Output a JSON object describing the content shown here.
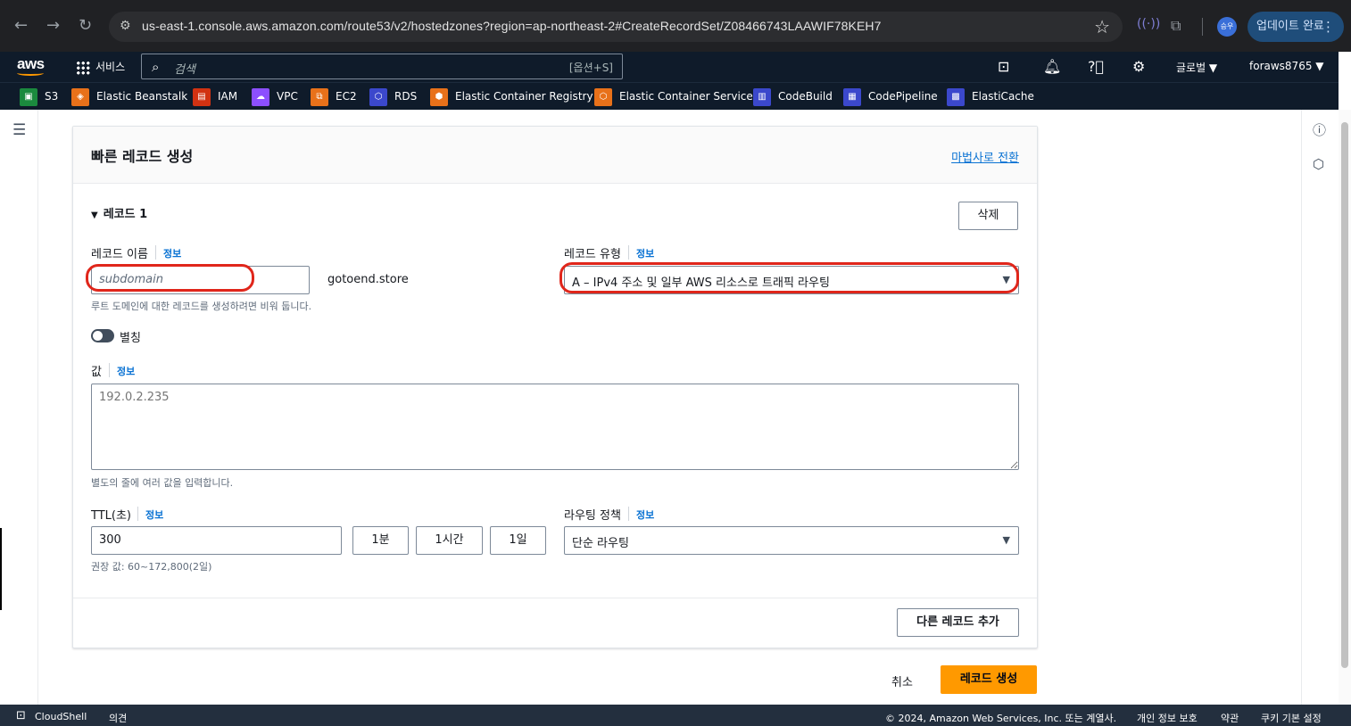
{
  "browser": {
    "url": "us-east-1.console.aws.amazon.com/route53/v2/hostedzones?region=ap-northeast-2#CreateRecordSet/Z08466743LAAWIF78KEH7",
    "update_label": "업데이트 완료",
    "profile_initial": "승우"
  },
  "awsnav": {
    "logo": "aws",
    "services": "서비스",
    "search_placeholder": "검색",
    "search_shortcut": "[옵션+S]",
    "region": "글로벌 ▼",
    "user": "foraws8765 ▼"
  },
  "favorites": [
    {
      "label": "S3",
      "color": "#1b8a3e"
    },
    {
      "label": "Elastic Beanstalk",
      "color": "#e8711a"
    },
    {
      "label": "IAM",
      "color": "#d13212"
    },
    {
      "label": "VPC",
      "color": "#8c4fff"
    },
    {
      "label": "EC2",
      "color": "#e8711a"
    },
    {
      "label": "RDS",
      "color": "#3b48cc"
    },
    {
      "label": "Elastic Container Registry",
      "color": "#e8711a"
    },
    {
      "label": "Elastic Container Service",
      "color": "#e8711a"
    },
    {
      "label": "CodeBuild",
      "color": "#3b48cc"
    },
    {
      "label": "CodePipeline",
      "color": "#3b48cc"
    },
    {
      "label": "ElastiCache",
      "color": "#3b48cc"
    }
  ],
  "page": {
    "title": "빠른 레코드 생성",
    "wizard_link": "마법사로 전환",
    "record_section": "레코드 1",
    "delete_button": "삭제",
    "record_name_label": "레코드 이름",
    "info": "정보",
    "record_name_placeholder": "subdomain",
    "domain_suffix": "gotoend.store",
    "record_name_hint": "루트 도메인에 대한 레코드를 생성하려면 비워 둡니다.",
    "record_type_label": "레코드 유형",
    "record_type_value": "A – IPv4 주소 및 일부 AWS 리소스로 트래픽 라우팅",
    "alias_label": "별칭",
    "value_label": "값",
    "value_placeholder": "192.0.2.235",
    "value_hint": "별도의 줄에 여러 값을 입력합니다.",
    "ttl_label": "TTL(초)",
    "ttl_value": "300",
    "ttl_1m": "1분",
    "ttl_1h": "1시간",
    "ttl_1d": "1일",
    "ttl_hint": "권장 값: 60~172,800(2일)",
    "routing_label": "라우팅 정책",
    "routing_value": "단순 라우팅",
    "add_record_button": "다른 레코드 추가",
    "cancel_button": "취소",
    "create_button": "레코드 생성"
  },
  "footer": {
    "cloudshell": "CloudShell",
    "feedback": "의견",
    "copyright": "© 2024, Amazon Web Services, Inc. 또는 계열사.",
    "privacy": "개인 정보 보호",
    "terms": "약관",
    "cookies": "쿠키 기본 설정"
  }
}
